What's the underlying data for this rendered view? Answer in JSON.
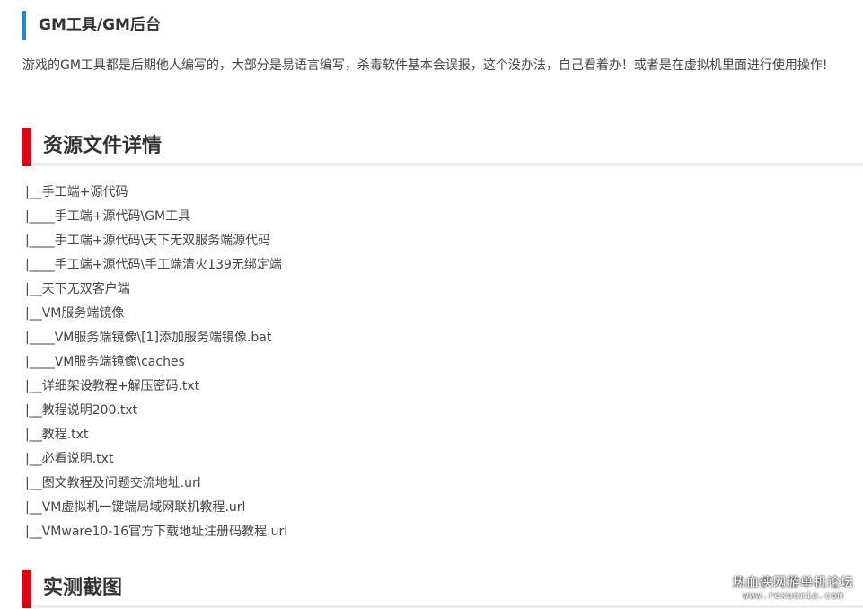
{
  "gm_section": {
    "heading": "GM工具/GM后台",
    "description": "游戏的GM工具都是后期他人编写的，大部分是易语言编写，杀毒软件基本会误报，这个没办法，自己看着办！或者是在虚拟机里面进行使用操作!"
  },
  "resource_section": {
    "heading": "资源文件详情",
    "files": [
      "|__手工端+源代码",
      "|____手工端+源代码\\GM工具",
      "|____手工端+源代码\\天下无双服务端源代码",
      "|____手工端+源代码\\手工端清火139无绑定端",
      "|__天下无双客户端",
      "|__VM服务端镜像",
      "|____VM服务端镜像\\[1]添加服务端镜像.bat",
      "|____VM服务端镜像\\caches",
      "|__详细架设教程+解压密码.txt",
      "|__教程说明200.txt",
      "|__教程.txt",
      "|__必看说明.txt",
      "|__图文教程及问题交流地址.url",
      "|__VM虚拟机一键端局域网联机教程.url",
      "|__VMware10-16官方下载地址注册码教程.url"
    ]
  },
  "screenshot_section": {
    "heading": "实测截图"
  },
  "watermark": {
    "title": "热血侠网游单机论坛",
    "url": "www.rexuexia.com"
  },
  "colors": {
    "blue_accent": "#1e88e5",
    "red_accent": "#e60012",
    "text": "#444444"
  }
}
